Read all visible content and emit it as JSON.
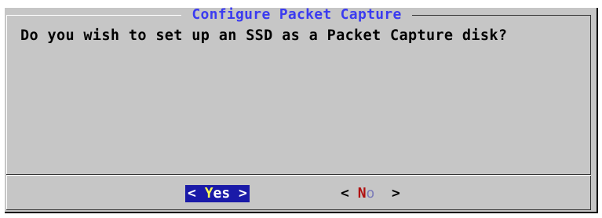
{
  "dialog": {
    "title": "Configure Packet Capture",
    "prompt": "Do you wish to set up an SSD as a Packet Capture disk?"
  },
  "buttons": {
    "yes": {
      "open": "< ",
      "hotkey": "Y",
      "rest": "es",
      "close": " >"
    },
    "no": {
      "open": "< ",
      "hotkey": "N",
      "rest": "o",
      "close": "  >"
    }
  },
  "colors": {
    "dialog_background": "#c6c6c6",
    "title_color": "#3b3bf0",
    "selected_button_bg": "#1a1aa8",
    "selected_hotkey": "#ffff55",
    "unselected_hotkey": "#b01010"
  }
}
